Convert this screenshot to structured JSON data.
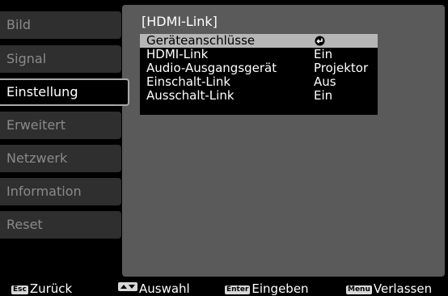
{
  "sidebar": {
    "items": [
      {
        "label": "Bild"
      },
      {
        "label": "Signal"
      },
      {
        "label": "Einstellung"
      },
      {
        "label": "Erweitert"
      },
      {
        "label": "Netzwerk"
      },
      {
        "label": "Information"
      },
      {
        "label": "Reset"
      }
    ],
    "active_index": 2
  },
  "panel": {
    "title": "[HDMI-Link]",
    "rows": [
      {
        "label": "Geräteanschlüsse",
        "value": ""
      },
      {
        "label": "HDMI-Link",
        "value": "Ein"
      },
      {
        "label": "Audio-Ausgangsgerät",
        "value": "Projektor"
      },
      {
        "label": "Einschalt-Link",
        "value": "Aus"
      },
      {
        "label": "Ausschalt-Link",
        "value": "Ein"
      }
    ],
    "selected_index": 0
  },
  "footer": {
    "back_key": "Esc",
    "back_label": "Zurück",
    "select_label": "Auswahl",
    "enter_key": "Enter",
    "enter_label": "Eingeben",
    "menu_key": "Menu",
    "menu_label": "Verlassen"
  },
  "icons": {
    "row_action": "enter-arrow-icon",
    "select_key": "up-down-arrows-icon"
  },
  "colors": {
    "panel_bg": "#5a5a5a",
    "selected_row_bg": "#b6b6b6",
    "sidebar_inactive_bg": "#2f2f2f"
  }
}
